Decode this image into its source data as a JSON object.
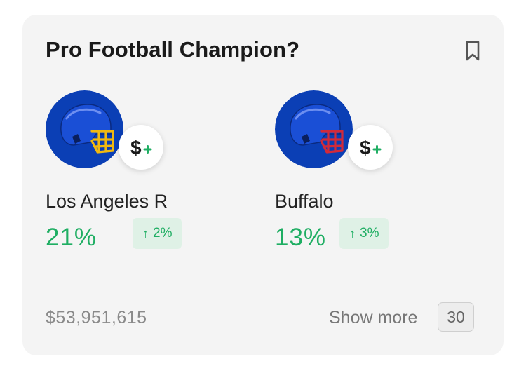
{
  "card": {
    "title": "Pro Football Champion?",
    "bookmark_icon": "bookmark-icon"
  },
  "markets": [
    {
      "team": "Los Angeles R",
      "probability": "21%",
      "change": "2%",
      "change_icon": "arrow-up-icon",
      "avatar_icon": "football-helmet-icon",
      "avatar_bg": "#0b3fb5",
      "helmet_facemask_color": "#f2b90f",
      "action_icon": "dollar-plus-icon"
    },
    {
      "team": "Buffalo",
      "probability": "13%",
      "change": "3%",
      "change_icon": "arrow-up-icon",
      "avatar_icon": "football-helmet-icon",
      "avatar_bg": "#0b3fb5",
      "helmet_facemask_color": "#d22a3a",
      "action_icon": "dollar-plus-icon"
    }
  ],
  "footer": {
    "volume": "$53,951,615",
    "show_more_label": "Show more",
    "more_count": "30"
  },
  "colors": {
    "positive": "#1fae63",
    "card_bg": "#f4f4f4"
  }
}
